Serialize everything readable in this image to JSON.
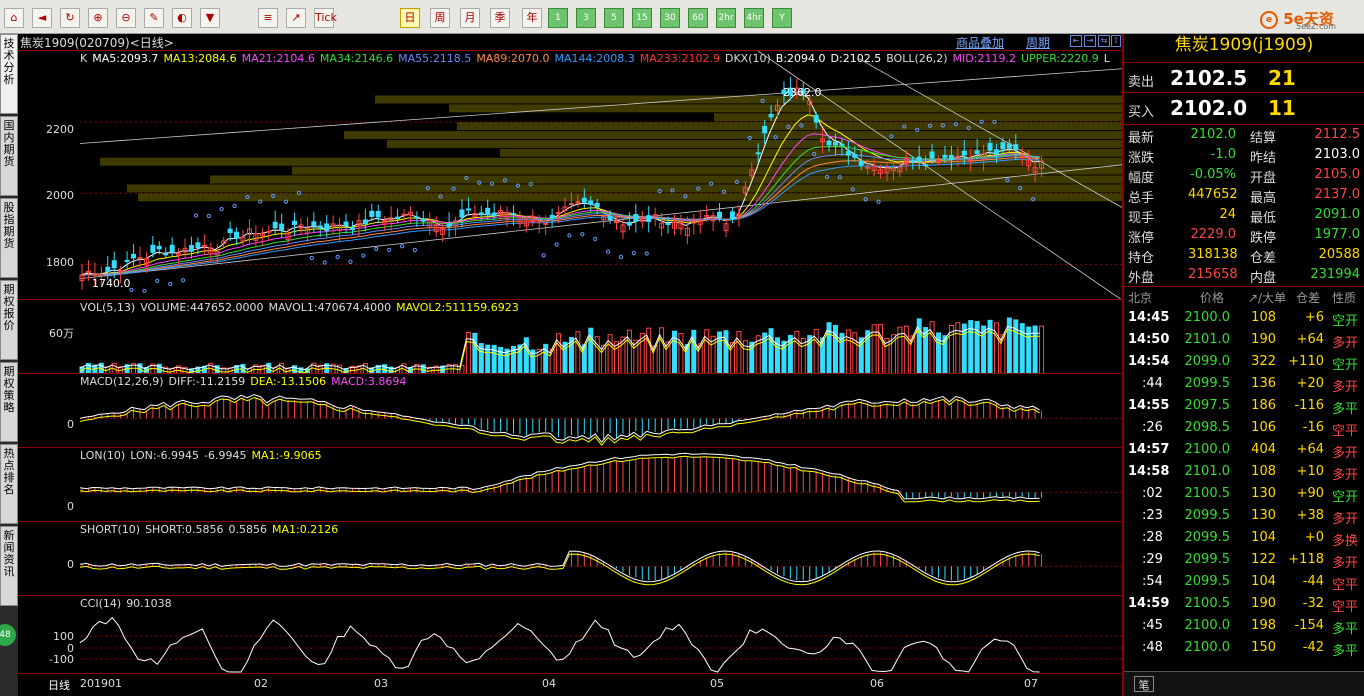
{
  "toolbar": {
    "icons": [
      "home-icon",
      "back-icon",
      "refresh-icon",
      "zoom-in-icon",
      "zoom-out-icon",
      "draw-icon",
      "color-icon",
      "filter-icon",
      "list-icon",
      "trend-icon",
      "tick-icon",
      "day-icon",
      "week-icon",
      "month-icon",
      "season-icon",
      "year-icon",
      "1min-icon",
      "3min-icon",
      "5min-icon",
      "15min-icon",
      "30min-icon",
      "60min-icon",
      "2hr-icon",
      "4hr-icon",
      "year-y-icon"
    ],
    "labels": {
      "tick": "Tick",
      "day": "日",
      "week": "周",
      "month": "月",
      "season": "季",
      "year": "年",
      "m1": "1",
      "m3": "3",
      "m5": "5",
      "m15": "15",
      "m30": "30",
      "m60": "60",
      "h2": "2hr",
      "h4": "4hr",
      "y": "Y"
    },
    "brand": "5e天资",
    "brand_sub": "5eeZ.com"
  },
  "left_tabs": [
    "技术分析",
    "国内期货",
    "股指期货",
    "期权报价",
    "期权策略",
    "热点排名",
    "新闻资讯"
  ],
  "badge": "48",
  "chart": {
    "title": "焦炭1909(020709)<日线>",
    "links": {
      "overlay": "商品叠加",
      "period": "周期"
    },
    "nav_buttons": [
      "⇤",
      "⇥",
      "⇆",
      "⇧"
    ],
    "ma_line": [
      {
        "t": "K",
        "c": "#dddddd"
      },
      {
        "t": "MA5:2093.7",
        "c": "#ffffff"
      },
      {
        "t": "MA13:2084.6",
        "c": "#ffff00"
      },
      {
        "t": "MA21:2104.6",
        "c": "#ff44ff"
      },
      {
        "t": "MA34:2146.6",
        "c": "#33dd33"
      },
      {
        "t": "MA55:2118.5",
        "c": "#6688ff"
      },
      {
        "t": "MA89:2070.0",
        "c": "#ff8844"
      },
      {
        "t": "MA144:2008.3",
        "c": "#3399ff"
      },
      {
        "t": "MA233:2102.9",
        "c": "#ff3333"
      },
      {
        "t": "DKX(10)",
        "c": "#dddddd"
      },
      {
        "t": "B:2094.0",
        "c": "#ffffff"
      },
      {
        "t": "D:2102.5",
        "c": "#ffffff"
      },
      {
        "t": "BOLL(26,2)",
        "c": "#dddddd"
      },
      {
        "t": "MID:2119.2",
        "c": "#ff44ff"
      },
      {
        "t": "UPPER:2220.9",
        "c": "#33dd33"
      },
      {
        "t": "L",
        "c": "#dddddd"
      }
    ],
    "y_labels": [
      "2200",
      "2000",
      "1800"
    ],
    "high_mark": "2362.0",
    "low_mark": "1740.0",
    "vol": {
      "label": "VOL(5,13)",
      "items": [
        {
          "t": "VOLUME:447652.0000",
          "c": "#dddddd"
        },
        {
          "t": "MAVOL1:470674.4000",
          "c": "#dddddd"
        },
        {
          "t": "MAVOL2:511159.6923",
          "c": "#ffff00"
        }
      ],
      "ylabel": "60万"
    },
    "macd": {
      "label": "MACD(12,26,9)",
      "items": [
        {
          "t": "DIFF:-11.2159",
          "c": "#dddddd"
        },
        {
          "t": "DEA:-13.1506",
          "c": "#ffff00"
        },
        {
          "t": "MACD:3.8694",
          "c": "#ff44ff"
        }
      ],
      "ylabel": "0"
    },
    "lon": {
      "label": "LON(10)",
      "items": [
        {
          "t": "LON:-6.9945",
          "c": "#dddddd"
        },
        {
          "t": "-6.9945",
          "c": "#dddddd"
        },
        {
          "t": "MA1:-9.9065",
          "c": "#ffff00"
        }
      ],
      "ylabel": "0"
    },
    "short": {
      "label": "SHORT(10)",
      "items": [
        {
          "t": "SHORT:0.5856",
          "c": "#dddddd"
        },
        {
          "t": "0.5856",
          "c": "#dddddd"
        },
        {
          "t": "MA1:0.2126",
          "c": "#ffff00"
        }
      ],
      "ylabel": "0"
    },
    "cci": {
      "label": "CCI(14)",
      "items": [
        {
          "t": "90.1038",
          "c": "#dddddd"
        }
      ],
      "ylabels": [
        "100",
        "0",
        "-100"
      ]
    },
    "x_labels": [
      "201901",
      "02",
      "03",
      "04",
      "05",
      "06",
      "07"
    ],
    "period_tab": "日线"
  },
  "quote": {
    "title": "焦炭1909(j1909)",
    "sell": {
      "label": "卖出",
      "price": "2102.5",
      "vol": "21"
    },
    "buy": {
      "label": "买入",
      "price": "2102.0",
      "vol": "11"
    },
    "rows": [
      {
        "l1": "最新",
        "v1": "2102.0",
        "c1": "#33dd33",
        "l2": "结算",
        "v2": "2112.5",
        "c2": "#ff4444"
      },
      {
        "l1": "涨跌",
        "v1": "-1.0",
        "c1": "#33dd33",
        "l2": "昨结",
        "v2": "2103.0",
        "c2": "#ffffff"
      },
      {
        "l1": "幅度",
        "v1": "-0.05%",
        "c1": "#33dd33",
        "l2": "开盘",
        "v2": "2105.0",
        "c2": "#ff4444"
      },
      {
        "l1": "总手",
        "v1": "447652",
        "c1": "#ffd800",
        "l2": "最高",
        "v2": "2137.0",
        "c2": "#ff4444"
      },
      {
        "l1": "现手",
        "v1": "24",
        "c1": "#ffd800",
        "l2": "最低",
        "v2": "2091.0",
        "c2": "#33dd33"
      },
      {
        "l1": "涨停",
        "v1": "2229.0",
        "c1": "#ff4444",
        "l2": "跌停",
        "v2": "1977.0",
        "c2": "#33dd33"
      },
      {
        "l1": "持仓",
        "v1": "318138",
        "c1": "#ffd800",
        "l2": "仓差",
        "v2": "20588",
        "c2": "#ffd800"
      },
      {
        "l1": "外盘",
        "v1": "215658",
        "c1": "#ff4444",
        "l2": "内盘",
        "v2": "231994",
        "c2": "#33dd33"
      }
    ],
    "tick_header": {
      "loc": "北京",
      "price": "价格",
      "vol": "↗/大单",
      "oi": "仓差",
      "nature": "性质"
    },
    "ticks": [
      {
        "t": "14:45",
        "p": "2100.0",
        "v": "108",
        "o": "+6",
        "n": "空开",
        "nc": "#33dd33"
      },
      {
        "t": "14:50",
        "p": "2101.0",
        "v": "190",
        "o": "+64",
        "n": "多开",
        "nc": "#ff4444"
      },
      {
        "t": "14:54",
        "p": "2099.0",
        "v": "322",
        "o": "+110",
        "n": "空开",
        "nc": "#33dd33"
      },
      {
        "t": ":44",
        "p": "2099.5",
        "v": "136",
        "o": "+20",
        "n": "多开",
        "nc": "#ff4444"
      },
      {
        "t": "14:55",
        "p": "2097.5",
        "v": "186",
        "o": "-116",
        "n": "多平",
        "nc": "#33dd33"
      },
      {
        "t": ":26",
        "p": "2098.5",
        "v": "106",
        "o": "-16",
        "n": "空平",
        "nc": "#ff4444"
      },
      {
        "t": "14:57",
        "p": "2100.0",
        "v": "404",
        "o": "+64",
        "n": "多开",
        "nc": "#ff4444"
      },
      {
        "t": "14:58",
        "p": "2101.0",
        "v": "108",
        "o": "+10",
        "n": "多开",
        "nc": "#ff4444"
      },
      {
        "t": ":02",
        "p": "2100.5",
        "v": "130",
        "o": "+90",
        "n": "空开",
        "nc": "#33dd33"
      },
      {
        "t": ":23",
        "p": "2099.5",
        "v": "130",
        "o": "+38",
        "n": "多开",
        "nc": "#ff4444"
      },
      {
        "t": ":28",
        "p": "2099.5",
        "v": "104",
        "o": "+0",
        "n": "多换",
        "nc": "#ff4444"
      },
      {
        "t": ":29",
        "p": "2099.5",
        "v": "122",
        "o": "+118",
        "n": "多开",
        "nc": "#ff4444"
      },
      {
        "t": ":54",
        "p": "2099.5",
        "v": "104",
        "o": "-44",
        "n": "空平",
        "nc": "#ff4444"
      },
      {
        "t": "14:59",
        "p": "2100.5",
        "v": "190",
        "o": "-32",
        "n": "空平",
        "nc": "#ff4444"
      },
      {
        "t": ":45",
        "p": "2100.0",
        "v": "198",
        "o": "-154",
        "n": "多平",
        "nc": "#33dd33"
      },
      {
        "t": ":48",
        "p": "2100.0",
        "v": "150",
        "o": "-42",
        "n": "多平",
        "nc": "#33dd33"
      }
    ],
    "bottom_tab": "笔"
  }
}
